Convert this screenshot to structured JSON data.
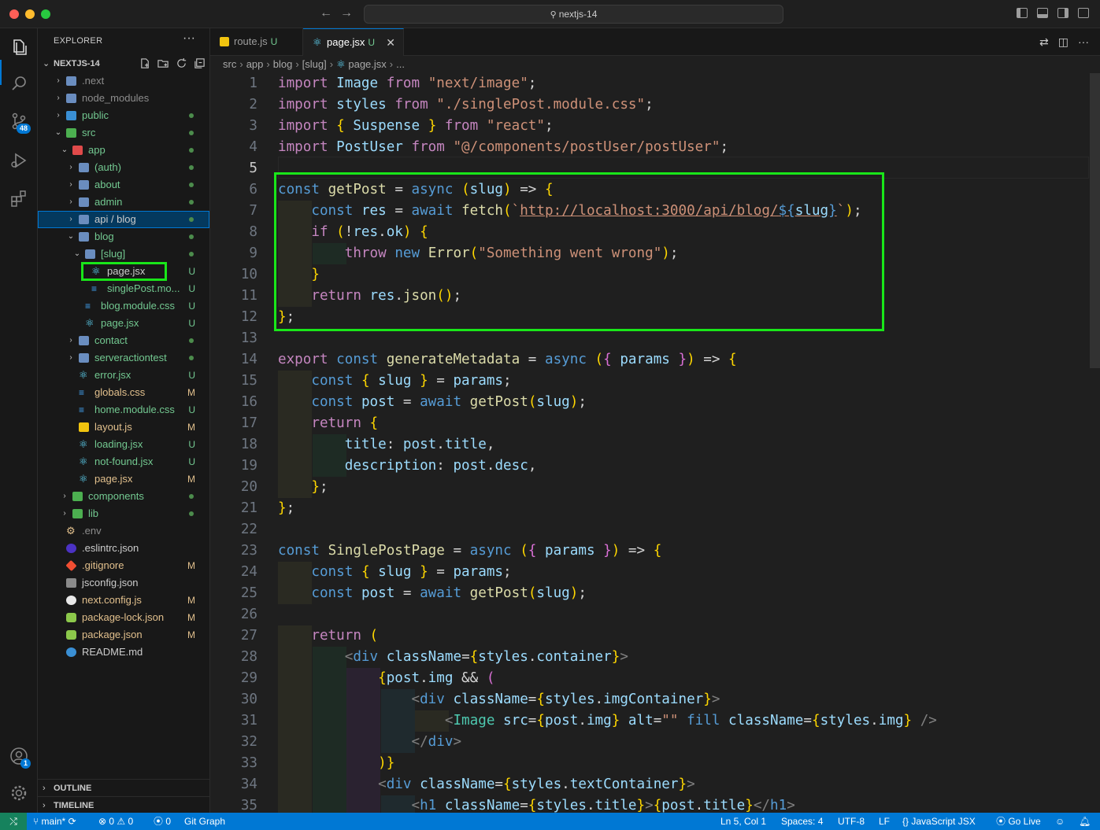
{
  "titlebar": {
    "search_label": "nextjs-14",
    "back_icon": "arrow-left-icon",
    "forward_icon": "arrow-right-icon"
  },
  "activity": {
    "source_control_badge": "48",
    "accounts_badge": "1"
  },
  "explorer": {
    "title": "EXPLORER",
    "more": "···",
    "root": "NEXTJS-14",
    "items": [
      {
        "name": ".next",
        "depth": 1,
        "type": "folder",
        "icon": "gear-folder",
        "color": "grey",
        "status": ""
      },
      {
        "name": "node_modules",
        "depth": 1,
        "type": "folder",
        "icon": "node-folder",
        "color": "grey",
        "status": ""
      },
      {
        "name": "public",
        "depth": 1,
        "type": "folder",
        "icon": "public-folder",
        "color": "green",
        "status": "dot"
      },
      {
        "name": "src",
        "depth": 1,
        "type": "folder-open",
        "icon": "src-folder",
        "color": "green",
        "status": "dot"
      },
      {
        "name": "app",
        "depth": 2,
        "type": "folder-open",
        "icon": "app-folder",
        "color": "green",
        "status": "dot"
      },
      {
        "name": "(auth)",
        "depth": 3,
        "type": "folder",
        "icon": "folder",
        "color": "green",
        "status": "dot"
      },
      {
        "name": "about",
        "depth": 3,
        "type": "folder",
        "icon": "folder",
        "color": "green",
        "status": "dot"
      },
      {
        "name": "admin",
        "depth": 3,
        "type": "folder",
        "icon": "admin-folder",
        "color": "green",
        "status": "dot"
      },
      {
        "name": "api / blog",
        "depth": 3,
        "type": "folder",
        "icon": "folder",
        "color": "white",
        "status": "dot"
      },
      {
        "name": "blog",
        "depth": 3,
        "type": "folder-open",
        "icon": "folder",
        "color": "green",
        "status": "dot"
      },
      {
        "name": "[slug]",
        "depth": 4,
        "type": "folder-open",
        "icon": "folder",
        "color": "green",
        "status": "dot"
      },
      {
        "name": "page.jsx",
        "depth": 5,
        "type": "file",
        "icon": "react",
        "color": "white",
        "status": "U"
      },
      {
        "name": "singlePost.mo...",
        "depth": 5,
        "type": "file",
        "icon": "css",
        "color": "green",
        "status": "U"
      },
      {
        "name": "blog.module.css",
        "depth": 4,
        "type": "file",
        "icon": "css",
        "color": "green",
        "status": "U"
      },
      {
        "name": "page.jsx",
        "depth": 4,
        "type": "file",
        "icon": "react",
        "color": "green",
        "status": "U"
      },
      {
        "name": "contact",
        "depth": 3,
        "type": "folder",
        "icon": "folder",
        "color": "green",
        "status": "dot"
      },
      {
        "name": "serveractiontest",
        "depth": 3,
        "type": "folder",
        "icon": "folder",
        "color": "green",
        "status": "dot"
      },
      {
        "name": "error.jsx",
        "depth": 3,
        "type": "file",
        "icon": "react",
        "color": "green",
        "status": "U"
      },
      {
        "name": "globals.css",
        "depth": 3,
        "type": "file",
        "icon": "css",
        "color": "yellow",
        "status": "M"
      },
      {
        "name": "home.module.css",
        "depth": 3,
        "type": "file",
        "icon": "css",
        "color": "green",
        "status": "U"
      },
      {
        "name": "layout.js",
        "depth": 3,
        "type": "file",
        "icon": "js",
        "color": "yellow",
        "status": "M"
      },
      {
        "name": "loading.jsx",
        "depth": 3,
        "type": "file",
        "icon": "react",
        "color": "green",
        "status": "U"
      },
      {
        "name": "not-found.jsx",
        "depth": 3,
        "type": "file",
        "icon": "react",
        "color": "green",
        "status": "U"
      },
      {
        "name": "page.jsx",
        "depth": 3,
        "type": "file",
        "icon": "react",
        "color": "yellow",
        "status": "M"
      },
      {
        "name": "components",
        "depth": 2,
        "type": "folder",
        "icon": "components-folder",
        "color": "green",
        "status": "dot"
      },
      {
        "name": "lib",
        "depth": 2,
        "type": "folder",
        "icon": "lib-folder",
        "color": "green",
        "status": "dot"
      },
      {
        "name": ".env",
        "depth": 1,
        "type": "file",
        "icon": "env",
        "color": "grey",
        "status": ""
      },
      {
        "name": ".eslintrc.json",
        "depth": 1,
        "type": "file",
        "icon": "eslint",
        "color": "white",
        "status": ""
      },
      {
        "name": ".gitignore",
        "depth": 1,
        "type": "file",
        "icon": "git",
        "color": "yellow",
        "status": "M"
      },
      {
        "name": "jsconfig.json",
        "depth": 1,
        "type": "file",
        "icon": "json",
        "color": "white",
        "status": ""
      },
      {
        "name": "next.config.js",
        "depth": 1,
        "type": "file",
        "icon": "next",
        "color": "yellow",
        "status": "M"
      },
      {
        "name": "package-lock.json",
        "depth": 1,
        "type": "file",
        "icon": "node",
        "color": "yellow",
        "status": "M"
      },
      {
        "name": "package.json",
        "depth": 1,
        "type": "file",
        "icon": "node",
        "color": "yellow",
        "status": "M"
      },
      {
        "name": "README.md",
        "depth": 1,
        "type": "file",
        "icon": "info",
        "color": "white",
        "status": ""
      }
    ],
    "outline_label": "OUTLINE",
    "timeline_label": "TIMELINE"
  },
  "tabs": [
    {
      "label": "route.js",
      "modified": "U",
      "icon": "js",
      "active": false
    },
    {
      "label": "page.jsx",
      "modified": "U",
      "icon": "react",
      "active": true
    }
  ],
  "breadcrumb": [
    "src",
    "app",
    "blog",
    "[slug]",
    "page.jsx",
    "..."
  ],
  "editor": {
    "current_line": 5,
    "lines": [
      "import Image from \"next/image\";",
      "import styles from \"./singlePost.module.css\";",
      "import { Suspense } from \"react\";",
      "import PostUser from \"@/components/postUser/postUser\";",
      "",
      "const getPost = async (slug) => {",
      "  const res = await fetch(`http://localhost:3000/api/blog/${slug}`);",
      "  if (!res.ok) {",
      "    throw new Error(\"Something went wrong\");",
      "  }",
      "  return res.json();",
      "};",
      "",
      "export const generateMetadata = async ({ params }) => {",
      "  const { slug } = params;",
      "  const post = await getPost(slug);",
      "  return {",
      "    title: post.title,",
      "    description: post.desc,",
      "  };",
      "};",
      "",
      "const SinglePostPage = async ({ params }) => {",
      "  const { slug } = params;",
      "  const post = await getPost(slug);",
      "",
      "  return (",
      "    <div className={styles.container}>",
      "      {post.img && (",
      "        <div className={styles.imgContainer}>",
      "          <Image src={post.img} alt=\"\" fill className={styles.img} />",
      "        </div>",
      "      )}",
      "      <div className={styles.textContainer}>",
      "        <h1 className={styles.title}>{post.title}</h1>"
    ]
  },
  "statusbar": {
    "branch": "main*",
    "errors": "0",
    "warnings": "0",
    "ports": "0",
    "git_graph": "Git Graph",
    "position": "Ln 5, Col 1",
    "spaces": "Spaces: 4",
    "encoding": "UTF-8",
    "eol": "LF",
    "language": "JavaScript JSX",
    "go_live": "Go Live"
  }
}
